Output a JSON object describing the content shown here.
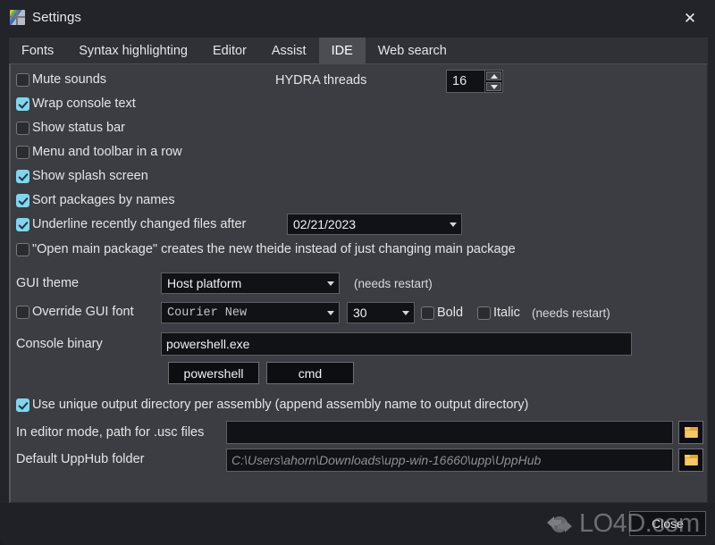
{
  "window": {
    "title": "Settings",
    "icon": "upp-logo-icon",
    "close_icon": "close-icon"
  },
  "tabs": [
    {
      "label": "Fonts",
      "active": false
    },
    {
      "label": "Syntax highlighting",
      "active": false
    },
    {
      "label": "Editor",
      "active": false
    },
    {
      "label": "Assist",
      "active": false
    },
    {
      "label": "IDE",
      "active": true
    },
    {
      "label": "Web search",
      "active": false
    }
  ],
  "checkboxes": [
    {
      "label": "Mute sounds",
      "checked": false
    },
    {
      "label": "Wrap console text",
      "checked": true
    },
    {
      "label": "Show status bar",
      "checked": false
    },
    {
      "label": "Menu and toolbar in a row",
      "checked": false
    },
    {
      "label": "Show splash screen",
      "checked": true
    },
    {
      "label": "Sort packages by names",
      "checked": true
    },
    {
      "label": "Underline recently changed files after",
      "checked": true
    },
    {
      "label": "\"Open main package\" creates the new theide instead of just changing main package",
      "checked": false
    }
  ],
  "hydra": {
    "label": "HYDRA threads",
    "value": "16",
    "up_icon": "spinner-up-icon",
    "down_icon": "spinner-down-icon"
  },
  "underline_date": {
    "value": "02/21/2023",
    "arrow_icon": "chevron-down-icon"
  },
  "gui_theme": {
    "label": "GUI theme",
    "value": "Host platform",
    "note": "(needs restart)",
    "arrow_icon": "chevron-down-icon"
  },
  "gui_font": {
    "label": "Override GUI font",
    "checked": false,
    "family": "Courier New",
    "size": "30",
    "bold_label": "Bold",
    "bold_checked": false,
    "italic_label": "Italic",
    "italic_checked": false,
    "note": "(needs restart)",
    "arrow_icon": "chevron-down-icon"
  },
  "console": {
    "label": "Console binary",
    "value": "powershell.exe",
    "buttons": [
      {
        "label": "powershell"
      },
      {
        "label": "cmd"
      }
    ]
  },
  "unique_output": {
    "label": "Use unique output directory per assembly (append assembly name to output directory)",
    "checked": true
  },
  "usc_path": {
    "label": "In editor mode, path for .usc files",
    "value": "",
    "placeholder": "",
    "browse_icon": "folder-icon"
  },
  "upphub_path": {
    "label": "Default UppHub folder",
    "value": "",
    "placeholder": "C:\\Users\\ahorn\\Downloads\\upp-win-16660\\upp\\UppHub",
    "browse_icon": "folder-icon"
  },
  "footer": {
    "close_label": "Close"
  },
  "watermark": {
    "text": "LO4D.com",
    "logo_icon": "lo4d-logo-icon"
  },
  "colors": {
    "accent_checkbox": "#7fd6f2",
    "panel_bg": "#3b3d42",
    "field_bg": "#101216",
    "active_tab": "#4b4d52",
    "folder_icon": "#e8a22e"
  }
}
